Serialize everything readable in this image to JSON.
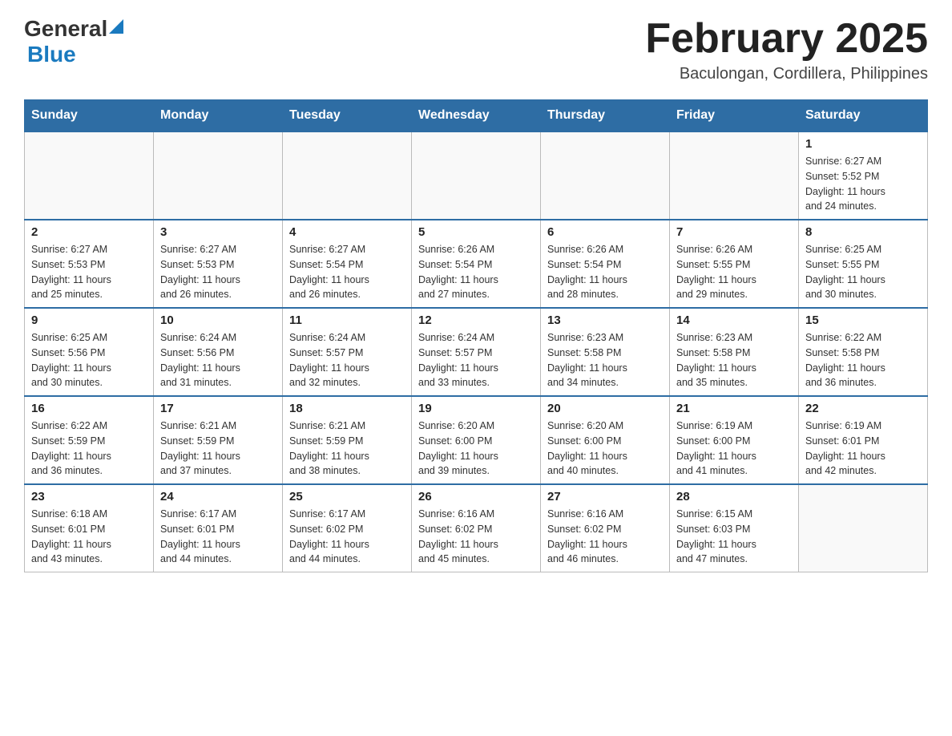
{
  "header": {
    "logo": {
      "general": "General",
      "blue": "Blue"
    },
    "title": "February 2025",
    "subtitle": "Baculongan, Cordillera, Philippines"
  },
  "calendar": {
    "days": [
      "Sunday",
      "Monday",
      "Tuesday",
      "Wednesday",
      "Thursday",
      "Friday",
      "Saturday"
    ],
    "weeks": [
      [
        {
          "day": "",
          "info": ""
        },
        {
          "day": "",
          "info": ""
        },
        {
          "day": "",
          "info": ""
        },
        {
          "day": "",
          "info": ""
        },
        {
          "day": "",
          "info": ""
        },
        {
          "day": "",
          "info": ""
        },
        {
          "day": "1",
          "info": "Sunrise: 6:27 AM\nSunset: 5:52 PM\nDaylight: 11 hours\nand 24 minutes."
        }
      ],
      [
        {
          "day": "2",
          "info": "Sunrise: 6:27 AM\nSunset: 5:53 PM\nDaylight: 11 hours\nand 25 minutes."
        },
        {
          "day": "3",
          "info": "Sunrise: 6:27 AM\nSunset: 5:53 PM\nDaylight: 11 hours\nand 26 minutes."
        },
        {
          "day": "4",
          "info": "Sunrise: 6:27 AM\nSunset: 5:54 PM\nDaylight: 11 hours\nand 26 minutes."
        },
        {
          "day": "5",
          "info": "Sunrise: 6:26 AM\nSunset: 5:54 PM\nDaylight: 11 hours\nand 27 minutes."
        },
        {
          "day": "6",
          "info": "Sunrise: 6:26 AM\nSunset: 5:54 PM\nDaylight: 11 hours\nand 28 minutes."
        },
        {
          "day": "7",
          "info": "Sunrise: 6:26 AM\nSunset: 5:55 PM\nDaylight: 11 hours\nand 29 minutes."
        },
        {
          "day": "8",
          "info": "Sunrise: 6:25 AM\nSunset: 5:55 PM\nDaylight: 11 hours\nand 30 minutes."
        }
      ],
      [
        {
          "day": "9",
          "info": "Sunrise: 6:25 AM\nSunset: 5:56 PM\nDaylight: 11 hours\nand 30 minutes."
        },
        {
          "day": "10",
          "info": "Sunrise: 6:24 AM\nSunset: 5:56 PM\nDaylight: 11 hours\nand 31 minutes."
        },
        {
          "day": "11",
          "info": "Sunrise: 6:24 AM\nSunset: 5:57 PM\nDaylight: 11 hours\nand 32 minutes."
        },
        {
          "day": "12",
          "info": "Sunrise: 6:24 AM\nSunset: 5:57 PM\nDaylight: 11 hours\nand 33 minutes."
        },
        {
          "day": "13",
          "info": "Sunrise: 6:23 AM\nSunset: 5:58 PM\nDaylight: 11 hours\nand 34 minutes."
        },
        {
          "day": "14",
          "info": "Sunrise: 6:23 AM\nSunset: 5:58 PM\nDaylight: 11 hours\nand 35 minutes."
        },
        {
          "day": "15",
          "info": "Sunrise: 6:22 AM\nSunset: 5:58 PM\nDaylight: 11 hours\nand 36 minutes."
        }
      ],
      [
        {
          "day": "16",
          "info": "Sunrise: 6:22 AM\nSunset: 5:59 PM\nDaylight: 11 hours\nand 36 minutes."
        },
        {
          "day": "17",
          "info": "Sunrise: 6:21 AM\nSunset: 5:59 PM\nDaylight: 11 hours\nand 37 minutes."
        },
        {
          "day": "18",
          "info": "Sunrise: 6:21 AM\nSunset: 5:59 PM\nDaylight: 11 hours\nand 38 minutes."
        },
        {
          "day": "19",
          "info": "Sunrise: 6:20 AM\nSunset: 6:00 PM\nDaylight: 11 hours\nand 39 minutes."
        },
        {
          "day": "20",
          "info": "Sunrise: 6:20 AM\nSunset: 6:00 PM\nDaylight: 11 hours\nand 40 minutes."
        },
        {
          "day": "21",
          "info": "Sunrise: 6:19 AM\nSunset: 6:00 PM\nDaylight: 11 hours\nand 41 minutes."
        },
        {
          "day": "22",
          "info": "Sunrise: 6:19 AM\nSunset: 6:01 PM\nDaylight: 11 hours\nand 42 minutes."
        }
      ],
      [
        {
          "day": "23",
          "info": "Sunrise: 6:18 AM\nSunset: 6:01 PM\nDaylight: 11 hours\nand 43 minutes."
        },
        {
          "day": "24",
          "info": "Sunrise: 6:17 AM\nSunset: 6:01 PM\nDaylight: 11 hours\nand 44 minutes."
        },
        {
          "day": "25",
          "info": "Sunrise: 6:17 AM\nSunset: 6:02 PM\nDaylight: 11 hours\nand 44 minutes."
        },
        {
          "day": "26",
          "info": "Sunrise: 6:16 AM\nSunset: 6:02 PM\nDaylight: 11 hours\nand 45 minutes."
        },
        {
          "day": "27",
          "info": "Sunrise: 6:16 AM\nSunset: 6:02 PM\nDaylight: 11 hours\nand 46 minutes."
        },
        {
          "day": "28",
          "info": "Sunrise: 6:15 AM\nSunset: 6:03 PM\nDaylight: 11 hours\nand 47 minutes."
        },
        {
          "day": "",
          "info": ""
        }
      ]
    ]
  }
}
